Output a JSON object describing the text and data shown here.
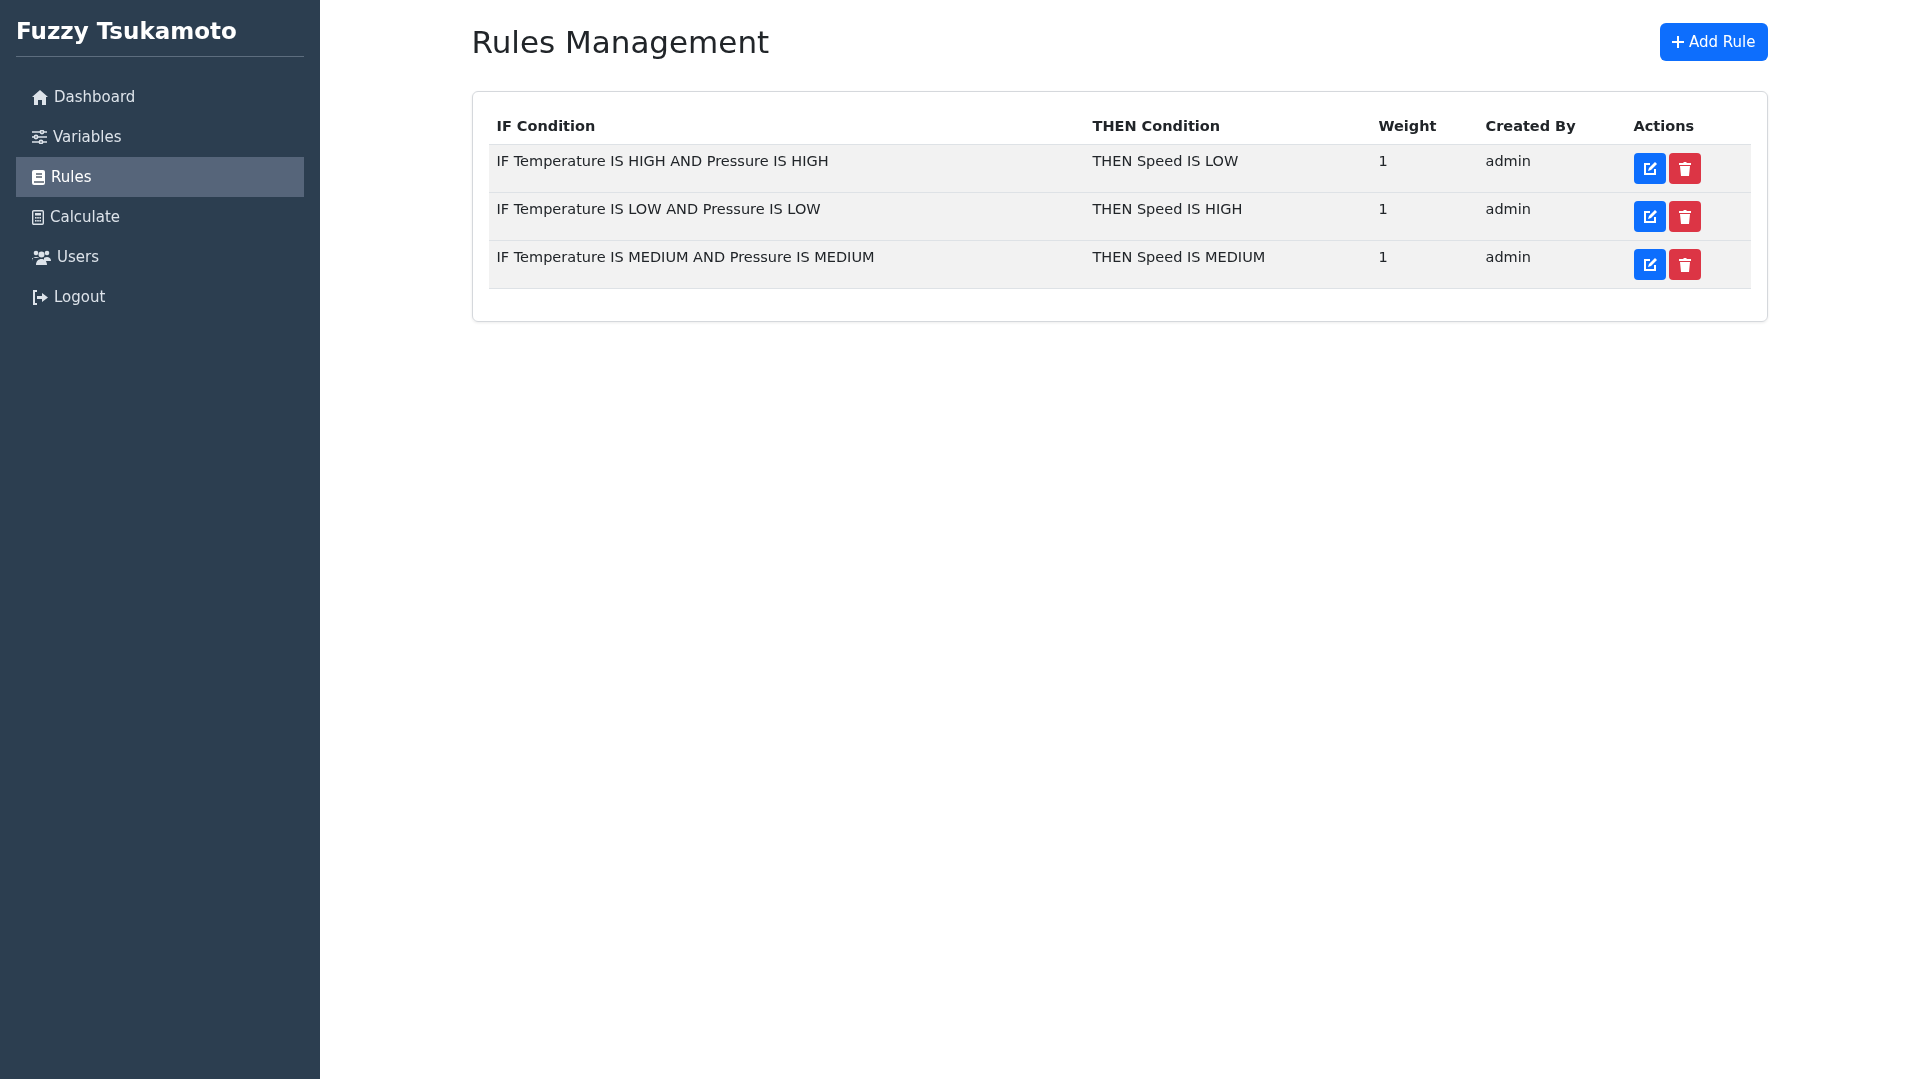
{
  "sidebar": {
    "brand": "Fuzzy Tsukamoto",
    "items": [
      {
        "label": "Dashboard",
        "selected": false
      },
      {
        "label": "Variables",
        "selected": false
      },
      {
        "label": "Rules",
        "selected": true
      },
      {
        "label": "Calculate",
        "selected": false
      },
      {
        "label": "Users",
        "selected": false
      },
      {
        "label": "Logout",
        "selected": false
      }
    ]
  },
  "header": {
    "title": "Rules Management",
    "add_button": "Add Rule"
  },
  "table": {
    "columns": [
      "IF Condition",
      "THEN Condition",
      "Weight",
      "Created By",
      "Actions"
    ],
    "rows": [
      {
        "if": "IF Temperature IS HIGH AND Pressure IS HIGH",
        "then": "THEN Speed IS LOW",
        "weight": "1",
        "created_by": "admin"
      },
      {
        "if": "IF Temperature IS LOW AND Pressure IS LOW",
        "then": "THEN Speed IS HIGH",
        "weight": "1",
        "created_by": "admin"
      },
      {
        "if": "IF Temperature IS MEDIUM AND Pressure IS MEDIUM",
        "then": "THEN Speed IS MEDIUM",
        "weight": "1",
        "created_by": "admin"
      }
    ]
  }
}
